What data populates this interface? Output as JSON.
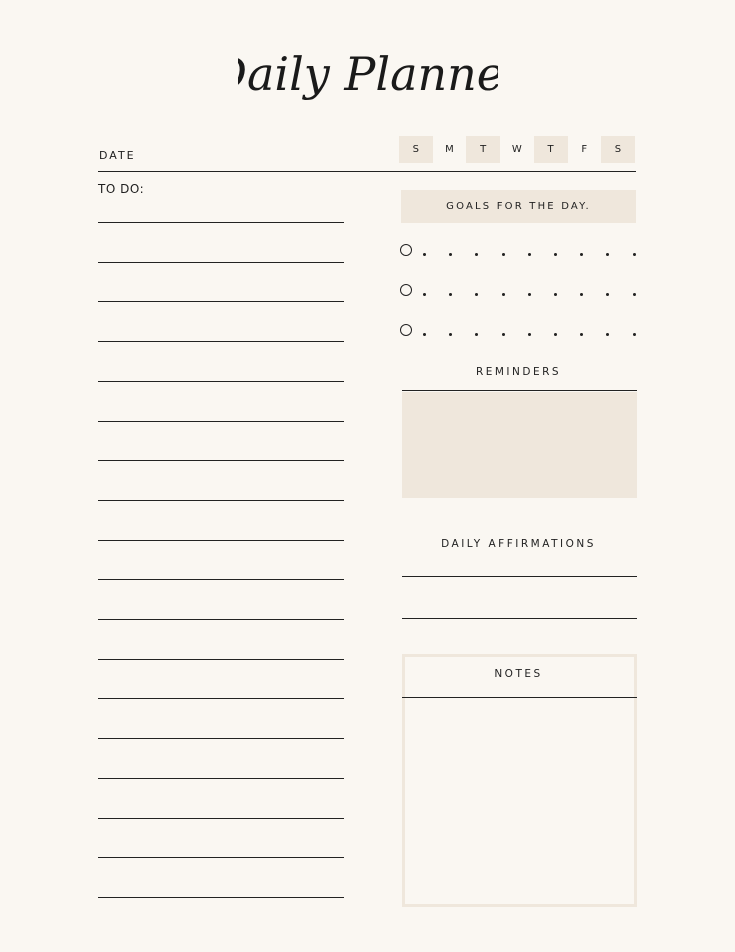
{
  "title": "Daily Planner",
  "date_label": "DATE",
  "todo_label": "TO DO:",
  "weekdays": [
    {
      "letter": "S",
      "shaded": true
    },
    {
      "letter": "M",
      "shaded": false
    },
    {
      "letter": "T",
      "shaded": true
    },
    {
      "letter": "W",
      "shaded": false
    },
    {
      "letter": "T",
      "shaded": true
    },
    {
      "letter": "F",
      "shaded": false
    },
    {
      "letter": "S",
      "shaded": true
    }
  ],
  "goals_title": "GOALS FOR THE DAY.",
  "reminders_title": "REMINDERS",
  "affirmations_title": "DAILY AFFIRMATIONS",
  "notes_title": "NOTES",
  "colors": {
    "background": "#faf7f2",
    "accent": "#efe7dc",
    "ink": "#222222"
  }
}
